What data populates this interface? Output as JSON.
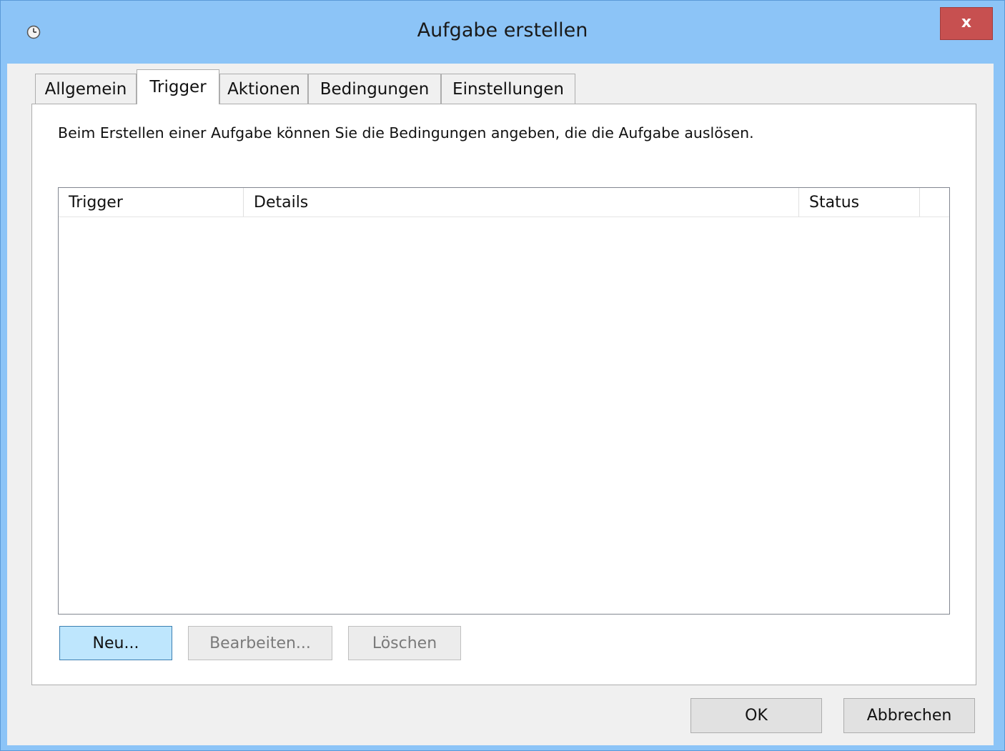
{
  "window": {
    "title": "Aufgabe erstellen",
    "close_label": "x",
    "icon": "clock-icon"
  },
  "tabs": [
    {
      "label": "Allgemein",
      "active": false
    },
    {
      "label": "Trigger",
      "active": true
    },
    {
      "label": "Aktionen",
      "active": false
    },
    {
      "label": "Bedingungen",
      "active": false
    },
    {
      "label": "Einstellungen",
      "active": false
    }
  ],
  "trigger_tab": {
    "description": "Beim Erstellen einer Aufgabe können Sie die Bedingungen angeben, die die Aufgabe auslösen.",
    "columns": [
      "Trigger",
      "Details",
      "Status"
    ],
    "rows": [],
    "buttons": {
      "new": "Neu...",
      "edit": "Bearbeiten...",
      "delete": "Löschen"
    }
  },
  "dialog_buttons": {
    "ok": "OK",
    "cancel": "Abbrechen"
  },
  "colors": {
    "titlebar": "#8cc4f7",
    "close": "#c75050",
    "default_button": "#bee6fd"
  }
}
